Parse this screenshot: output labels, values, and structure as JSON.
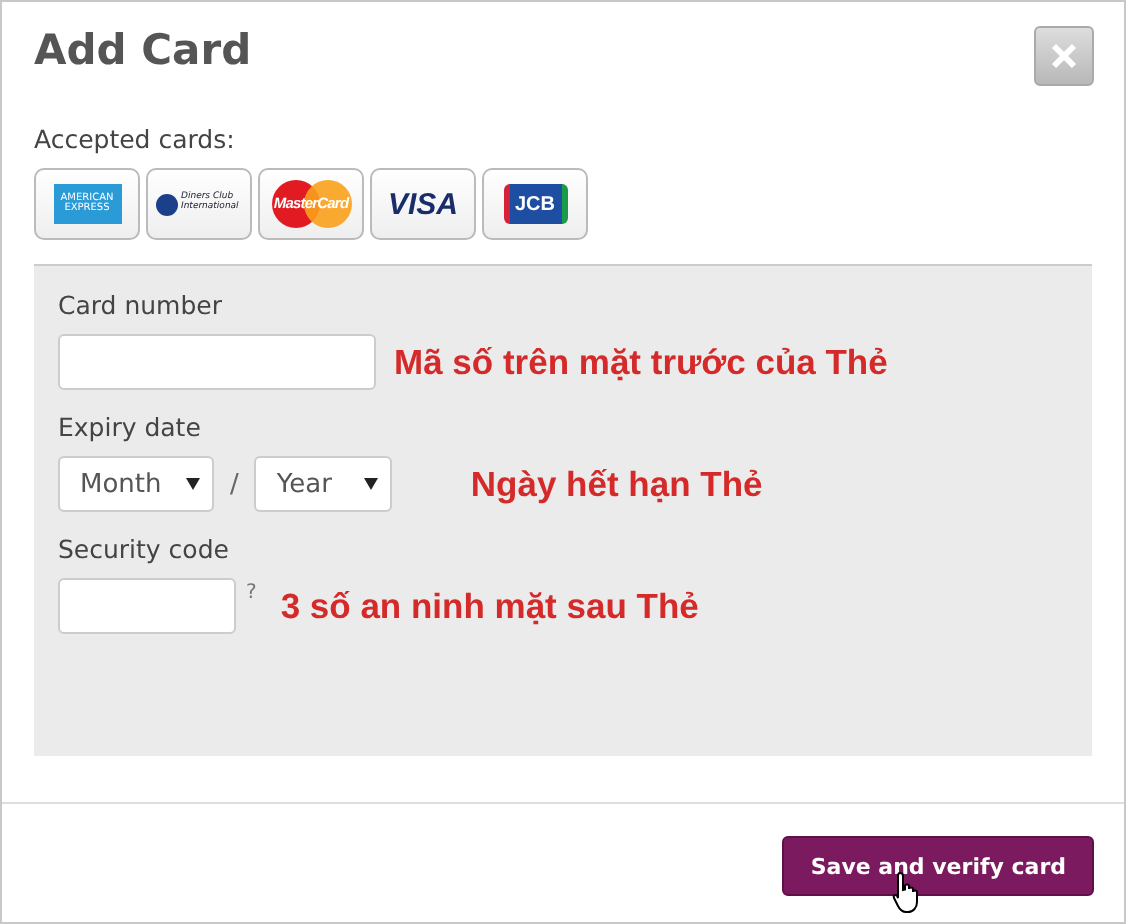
{
  "dialog": {
    "title": "Add Card"
  },
  "accepted_cards": {
    "label": "Accepted cards:",
    "cards": [
      {
        "kind": "amex",
        "text": "AMERICAN EXPRESS"
      },
      {
        "kind": "diners",
        "text": "Diners Club International"
      },
      {
        "kind": "mastercard",
        "text": "MasterCard"
      },
      {
        "kind": "visa",
        "text": "VISA"
      },
      {
        "kind": "jcb",
        "text": "JCB"
      }
    ]
  },
  "form": {
    "fields": [
      {
        "kind": "text",
        "label": "Card number",
        "annotation": "Mã số trên mặt trước của Thẻ"
      },
      {
        "kind": "expiry",
        "label": "Expiry date",
        "month": "Month",
        "separator": "/",
        "year": "Year",
        "annotation": "Ngày hết hạn Thẻ"
      },
      {
        "kind": "cvc",
        "label": "Security code",
        "help": "?",
        "annotation": "3 số an ninh mặt sau Thẻ"
      }
    ]
  },
  "footer": {
    "button": "Save and verify card"
  }
}
